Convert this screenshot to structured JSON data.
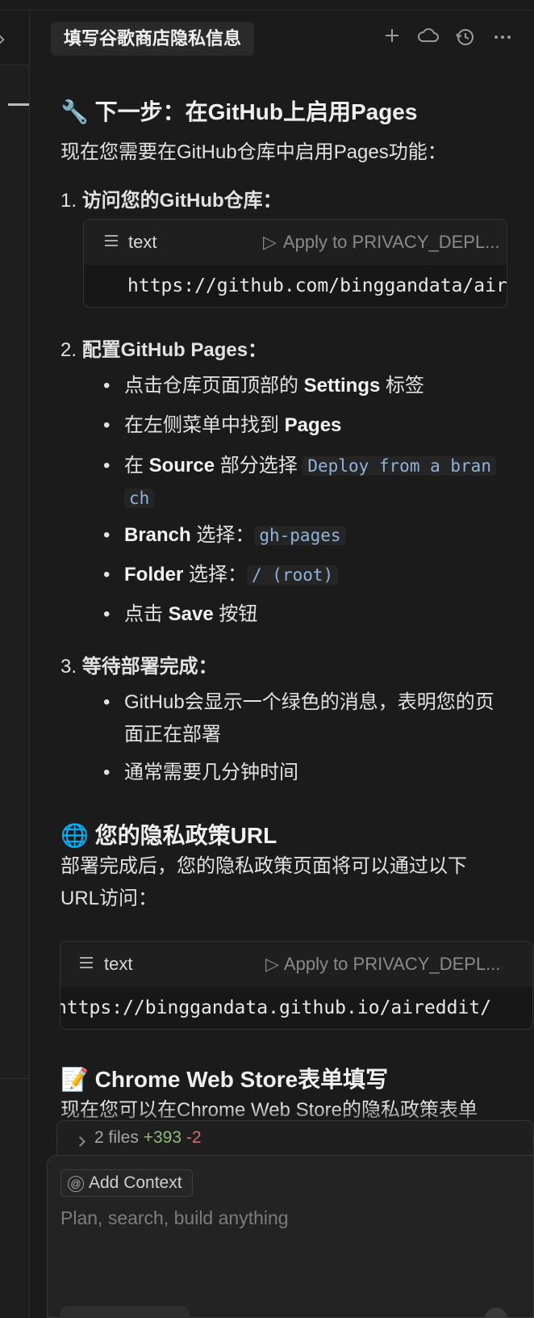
{
  "header": {
    "title": "填写谷歌商店隐私信息",
    "icons": [
      "plus-icon",
      "cloud-icon",
      "history-icon",
      "more-icon"
    ]
  },
  "content": {
    "section1_title": "🔧 下一步：在GitHub上启用Pages",
    "intro": "现在您需要在GitHub仓库中启用Pages功能：",
    "step1": {
      "num": "1.",
      "label": "访问您的GitHub仓库："
    },
    "codeblock1": {
      "lang": "text",
      "apply": "Apply to PRIVACY_DEPL...",
      "code": "https://github.com/binggandata/aireddit"
    },
    "step2": {
      "num": "2.",
      "label": "配置GitHub Pages："
    },
    "step2_items": {
      "item1": {
        "pre": "点击仓库页面顶部的 ",
        "bold": "Settings",
        "post": " 标签"
      },
      "item2": {
        "pre": "在左侧菜单中找到 ",
        "bold": "Pages"
      },
      "item3": {
        "pre": "在 ",
        "bold": "Source",
        "post": " 部分选择 ",
        "code1": "Deploy from a bran",
        "code2": "ch"
      },
      "item4": {
        "bold": "Branch",
        "post": " 选择：",
        "code": "gh-pages"
      },
      "item5": {
        "bold": "Folder",
        "post": " 选择：",
        "code": "/ (root)"
      },
      "item6": {
        "pre": "点击 ",
        "bold": "Save",
        "post": " 按钮"
      }
    },
    "step3": {
      "num": "3.",
      "label": "等待部署完成："
    },
    "step3_items": {
      "item1_line1": "GitHub会显示一个绿色的消息，表明您的页",
      "item1_line2": "面正在部署",
      "item2": "通常需要几分钟时间"
    },
    "section2_title": "🌐 您的隐私政策URL",
    "para2_line1": "部署完成后，您的隐私政策页面将可以通过以下",
    "para2_line2": "URL访问：",
    "codeblock2": {
      "lang": "text",
      "apply": "Apply to PRIVACY_DEPL...",
      "code": "https://binggandata.github.io/aireddit/"
    },
    "section3_title": "📝 Chrome Web Store表单填写",
    "para3_partial": "现在您可以在Chrome Web Store的隐私政策表单"
  },
  "composer": {
    "files_label": "2 files",
    "additions": "+393",
    "deletions": "-2",
    "add_context": "Add Context",
    "placeholder": "Plan, search, build anything"
  }
}
